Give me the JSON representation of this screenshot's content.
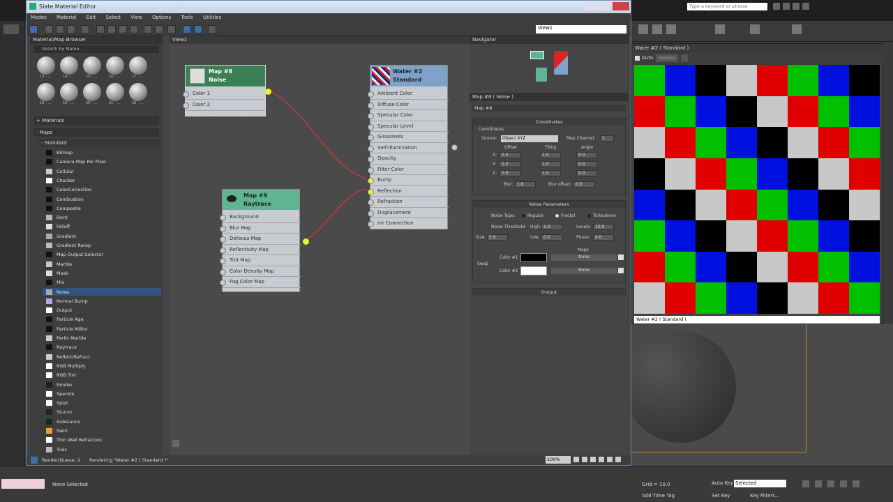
{
  "window": {
    "title": "Slate Material Editor",
    "menu": [
      "Modes",
      "Material",
      "Edit",
      "Select",
      "View",
      "Options",
      "Tools",
      "Utilities"
    ],
    "view_select": "View1",
    "search_placeholder": "Type a keyword or phrase"
  },
  "browser": {
    "header": "Material/Map Browser",
    "search": "Search by Name ...",
    "sphere_labels": [
      "13 - ...",
      "14 - ...",
      "15 - ...",
      "16 - ...",
      "17 - ...",
      "18 - ...",
      "19 - ...",
      "20 - ...",
      "21 - ...",
      "22 - ...",
      "23 - ...",
      "24 - ..."
    ],
    "section_materials": "+ Materials",
    "section_maps": "- Maps",
    "section_standard": "- Standard",
    "maps": [
      "Bitmap",
      "Camera Map Per Pixel",
      "Cellular",
      "Checker",
      "ColorCorrection",
      "Combustion",
      "Composite",
      "Dent",
      "Falloff",
      "Gradient",
      "Gradient Ramp",
      "Map Output Selector",
      "Marble",
      "Mask",
      "Mix",
      "Noise",
      "Normal Bump",
      "Output",
      "Particle Age",
      "Particle MBlur",
      "Perlin Marble",
      "Raytrace",
      "Reflect/Refract",
      "RGB Multiply",
      "RGB Tint",
      "Smoke",
      "Speckle",
      "Splat",
      "Stucco",
      "Substance",
      "Swirl",
      "Thin Wall Refraction",
      "Tiles"
    ],
    "selected": "Noise"
  },
  "view": {
    "tab": "View1",
    "noise_node": {
      "title": "Map #8",
      "subtitle": "Noise",
      "slots": [
        "Color 1",
        "Color 2"
      ]
    },
    "raytrace_node": {
      "title": "Map #9",
      "subtitle": "Raytrace",
      "slots": [
        "Background",
        "Blur Map",
        "Defocus Map",
        "Reflectivity Map",
        "Tint Map",
        "Color Density Map",
        "Fog Color Map"
      ]
    },
    "water_node": {
      "title": "Water #2",
      "subtitle": "Standard",
      "slots": [
        "Ambient Color",
        "Diffuse Color",
        "Specular Color",
        "Specular Level",
        "Glossiness",
        "Self-Illumination",
        "Opacity",
        "Filter Color",
        "Bump",
        "Reflection",
        "Refraction",
        "Displacement",
        "mr Connection"
      ]
    }
  },
  "navigator": {
    "title": "Navigator"
  },
  "params": {
    "header": "Map #8  ( Noise )",
    "name": "Map #8",
    "coords_title": "Coordinates",
    "coords_group": "Coordinates",
    "source_label": "Source:",
    "source_value": "Object XYZ",
    "map_channel_label": "Map Channel:",
    "map_channel_value": "1",
    "col_headers": [
      "Offset",
      "Tiling",
      "Angle"
    ],
    "axes": [
      "X:",
      "Y:",
      "Z:"
    ],
    "offset": [
      "0.0",
      "0.0",
      "0.0"
    ],
    "tiling": [
      "1.0",
      "1.0",
      "1.0"
    ],
    "angle": [
      "0.0",
      "0.0",
      "0.0"
    ],
    "blur_label": "Blur:",
    "blur_value": "1.0",
    "blur_offset_label": "Blur offset:",
    "blur_offset_value": "0.0",
    "noise_title": "Noise Parameters",
    "noise_type_label": "Noise Type:",
    "noise_types": [
      "Regular",
      "Fractal",
      "Turbulence"
    ],
    "threshold_label": "Noise Threshold:",
    "high_label": "High:",
    "high_value": "1.0",
    "levels_label": "Levels:",
    "levels_value": "10.0",
    "size_label": "Size:",
    "size_value": "5.0",
    "low_label": "Low:",
    "low_value": "0.0",
    "phase_label": "Phase:",
    "phase_value": "0.0",
    "maps_label": "Maps",
    "swap_label": "Swap",
    "color1_label": "Color #1",
    "color2_label": "Color #2",
    "none": "None",
    "output_title": "Output"
  },
  "status": {
    "left": "Render/Queue: 2",
    "right": "Rendering \"Water #2 ( Standard )\"",
    "zoom": "100%"
  },
  "preview": {
    "title": "Water #2  ( Standard )",
    "auto": "Auto",
    "update": "Update",
    "select": "Water #2  ( Standard )"
  },
  "bottom": {
    "status": "None Selected",
    "grid": "Grid = 10.0",
    "autokey": "Auto Key",
    "selected": "Selected",
    "setkey": "Set Key",
    "keyfilters": "Key Filters...",
    "addtime": "Add Time Tag"
  },
  "checker_colors": [
    "#ffffff",
    "#000000",
    "#e00000",
    "#00c000",
    "#0010e0",
    "#c8c8c8"
  ],
  "checker_grid": [
    [
      3,
      4,
      1,
      5,
      2,
      3,
      4,
      1
    ],
    [
      2,
      3,
      4,
      1,
      5,
      2,
      3,
      4
    ],
    [
      5,
      2,
      3,
      4,
      1,
      5,
      2,
      3
    ],
    [
      1,
      5,
      2,
      3,
      4,
      1,
      5,
      2
    ],
    [
      4,
      1,
      5,
      2,
      3,
      4,
      1,
      5
    ],
    [
      3,
      4,
      1,
      5,
      2,
      3,
      4,
      1
    ],
    [
      2,
      3,
      4,
      1,
      5,
      2,
      3,
      4
    ],
    [
      5,
      2,
      3,
      4,
      1,
      5,
      2,
      3
    ]
  ]
}
